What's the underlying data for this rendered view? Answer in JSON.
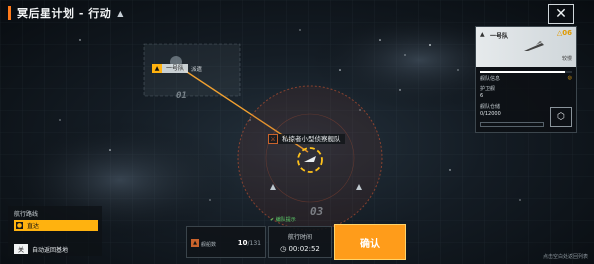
{
  "header": {
    "title": "冥后星计划 - 行动",
    "info_icon": "alert-icon",
    "extra": ""
  },
  "close": {
    "label": "✕",
    "icon": "close-icon"
  },
  "map": {
    "fleet_tag_label": "一号队",
    "fleet_tag_extra": "派遣",
    "zone_labels": [
      "01",
      "03"
    ],
    "enemy_label": "私掠者小型侦察舰队"
  },
  "fleet_panel": {
    "name": "一号队",
    "level": "△06",
    "speed": "较慢",
    "info_label": "舰队信息",
    "info_badge": "◎",
    "guard_label": "护卫舰",
    "guard_value": "6",
    "cargo_label": "舰队仓储",
    "cargo_value": "0/12000",
    "cargo_fill": 0.0,
    "bar_fill": 0.92
  },
  "route_panel": {
    "title": "航行路线",
    "option": "直达",
    "toggle": "关",
    "toggle_label": "自动返回基地"
  },
  "bottom_bar": {
    "tip": "编队提示",
    "count_label": "舰船数",
    "count": "10",
    "count_total": "/131",
    "time_label": "航行时间",
    "time_value": "00:02:52",
    "confirm": "确认"
  },
  "hint": "点击空白处返回列表",
  "colors": {
    "accent": "#ff9c1a",
    "route": "#f0a030",
    "danger": "#e06028"
  }
}
